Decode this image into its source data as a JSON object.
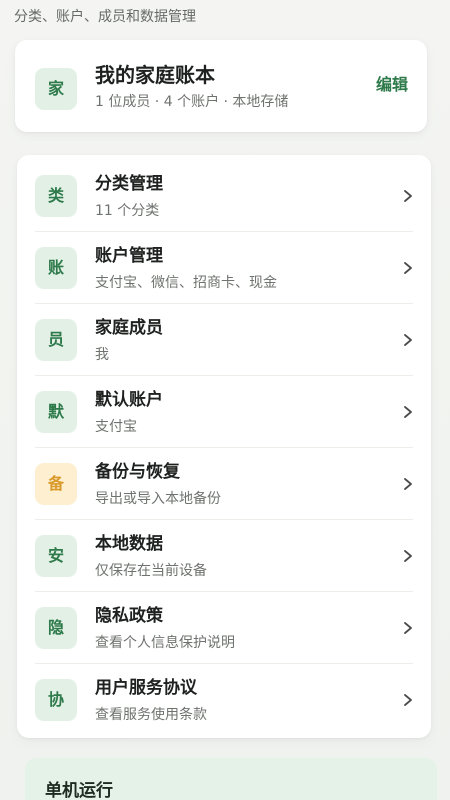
{
  "page": {
    "subtitle": "分类、账户、成员和数据管理"
  },
  "ledger": {
    "icon": "家",
    "title": "我的家庭账本",
    "summary": "1 位成员 · 4 个账户 · 本地存储",
    "edit_label": "编辑"
  },
  "settings": {
    "items": [
      {
        "icon": "类",
        "title": "分类管理",
        "description": "11 个分类"
      },
      {
        "icon": "账",
        "title": "账户管理",
        "description": "支付宝、微信、招商卡、现金"
      },
      {
        "icon": "员",
        "title": "家庭成员",
        "description": "我"
      },
      {
        "icon": "默",
        "title": "默认账户",
        "description": "支付宝"
      },
      {
        "icon": "备",
        "title": "备份与恢复",
        "description": "导出或导入本地备份"
      },
      {
        "icon": "安",
        "title": "本地数据",
        "description": "仅保存在当前设备"
      },
      {
        "icon": "隐",
        "title": "隐私政策",
        "description": "查看个人信息保护说明"
      },
      {
        "icon": "协",
        "title": "用户服务协议",
        "description": "查看服务使用条款"
      }
    ]
  },
  "offline_card": {
    "title": "单机运行"
  },
  "icons": {
    "row_arrow": "chevron-right-icon"
  },
  "colors": {
    "accent": "#2e7a4b",
    "icon_tint": "#e2f0e5",
    "backup_tint": "#fdefcf",
    "backup_accent": "#d99a2b",
    "offline_card": "#e5f2e7"
  }
}
